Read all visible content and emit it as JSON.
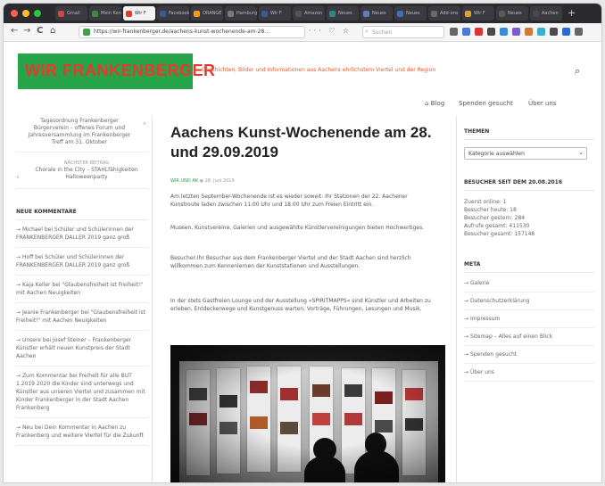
{
  "browser": {
    "tabs": [
      {
        "title": "Gmail",
        "color": "#d44638",
        "active": false
      },
      {
        "title": "Mein Konto",
        "color": "#3c8c3c",
        "active": false
      },
      {
        "title": "Wir F",
        "color": "#e53b2c",
        "active": true
      },
      {
        "title": "Facebook",
        "color": "#3b5998",
        "active": false
      },
      {
        "title": "ORANGE",
        "color": "#f39c12",
        "active": false
      },
      {
        "title": "Hamburg",
        "color": "#7a7a7a",
        "active": false
      },
      {
        "title": "Wir F",
        "color": "#3b5998",
        "active": false
      },
      {
        "title": "Amazon",
        "color": "#555555",
        "active": false
      },
      {
        "title": "Neues",
        "color": "#2a8a8a",
        "active": false
      },
      {
        "title": "Neues",
        "color": "#5a7fbf",
        "active": false
      },
      {
        "title": "Neues",
        "color": "#3c6fbf",
        "active": false
      },
      {
        "title": "Add-ons",
        "color": "#6a6a6a",
        "active": false
      },
      {
        "title": "Wir F",
        "color": "#e0a030",
        "active": false
      },
      {
        "title": "Neues",
        "color": "#5a5a5a",
        "active": false
      },
      {
        "title": "Aachen",
        "color": "#4a4a4a",
        "active": false
      }
    ],
    "new_tab": "+",
    "back": "←",
    "forward": "→",
    "reload": "C",
    "home": "⌂",
    "url": "https://wir-frankenberger.de/aachens-kunst-wochenende-am-28...",
    "page_actions": "··· ♡ ☆",
    "search_placeholder": "Suchen",
    "ext_colors": [
      "#666666",
      "#4a7bd0",
      "#d33",
      "#4a4a4a",
      "#3a8cd0",
      "#7a5ad0",
      "#d07a3a",
      "#3ab0d0",
      "#4a4a4a",
      "#2a6ad0",
      "#666666"
    ]
  },
  "header": {
    "logo_text": "WIR FRANKENBERGER",
    "tagline": "Geschichten, Bilder und Informationen aus Aachens ehrlichstem Viertel und der Region",
    "search_icon": "search-icon",
    "nav": [
      "Blog",
      "Spenden gesucht",
      "Über uns"
    ]
  },
  "left": {
    "prev_post": "Tagesordnung Frankenberger Bürgerverein – offenes Forum und Jahresversammlung im Frankenberger Treff am 31. Oktober",
    "next_label": "NÄCHSTER BEITRAG",
    "next_post": "Chorale in the City – STAHLfähigkeiten Halloweenparty",
    "comments_head": "NEUE KOMMENTARE",
    "comments": [
      "Michael bei Schüler und Schülerinnen der FRANKENBERGER DALLER 2019 ganz groß",
      "Hoff bei Schüler und Schülerinnen der FRANKENBERGER DALLER 2019 ganz groß",
      "Kaja Keller bei \"Glaubensfreiheit ist Freiheit!\" mit Aachen Neuigkeiten",
      "Jeanie Frankenberger bei \"Glaubensfreiheit ist Freiheit!\" mit Aachen Neuigkeiten",
      "Unsere bei Josef Steiner – Frankenberger Künstler erhält neuen Kunstpreis der Stadt Aachen",
      "Zum Kommentar bei Freiheit für alle BUT 1.2019 2020 die Kinder sind unterwegs und Künstler aus unseren Viertel und zusammen mit Kinder Frankenberger in der Stadt Aachen Frankenberg",
      "Neu bei Dein Kommentar in Aachen zu Frankenberg und weitere Viertel für die Zukunft"
    ]
  },
  "post": {
    "title": "Aachens Kunst-Wochenende am 28. und 29.09.2019",
    "author": "WIR UND AK",
    "date": "28. Juni 2019",
    "paragraphs": [
      "Am letzten September-Wochenende ist es wieder soweit: Ihr Stationen der 22. Aachener Kunstroute laden zwischen 11.00 Uhr und 18.00 Uhr zum Freien Eintritt ein.",
      "Museen, Kunstvereine, Galerien und ausgewählte Künstlervereinigungen bieten Hochwertiges.",
      "Besucher:Ihr Besucher aus dem Frankenberger Viertel und der Stadt Aachen sind herzlich willkommen zum Kennenlernen der Kunststationen und Ausstellungen.",
      "In der stets Gastfreien Lounge und der Ausstellung »SPIRITMAPPS« sind Künstler und Arbeiten zu erleben, Entdeckerwege und Kunstgenuss warten, Vorträge, Führungen, Lesungen und Musik."
    ]
  },
  "right": {
    "themes_head": "THEMEN",
    "themes_select": "Kategorie auswählen",
    "since_head": "BESUCHER SEIT DEM 20.08.2016",
    "stats": [
      "Zuerst online: 1",
      "Besucher heute: 18",
      "Besucher gestern: 284",
      "Aufrufe gesamt: 411530",
      "Besucher gesamt: 157148"
    ],
    "meta_head": "META",
    "menu": [
      "Galerie",
      "Datenschutzerklärung",
      "Impressum",
      "Sitemap – Alles auf einen Blick",
      "Spenden gesucht",
      "Über uns"
    ]
  }
}
